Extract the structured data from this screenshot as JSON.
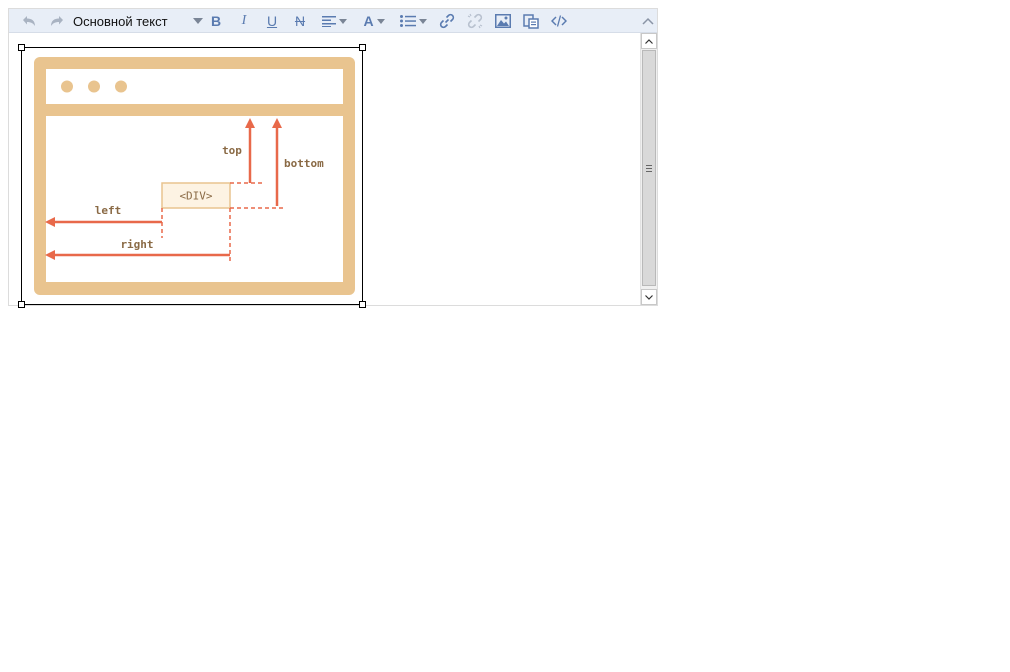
{
  "toolbar": {
    "undo_icon": "undo-icon",
    "redo_icon": "redo-icon",
    "paragraph_style": "Основной текст",
    "bold_label": "B",
    "italic_label": "I",
    "underline_label": "U",
    "strikethrough_label": "N",
    "text_color_label": "A",
    "icons": [
      "align-icon",
      "text-color-icon",
      "list-icon",
      "link-icon",
      "unlink-icon",
      "image-icon",
      "paste-icon",
      "source-code-icon",
      "collapse-toolbar-icon"
    ]
  },
  "diagram": {
    "labels": {
      "top": "top",
      "bottom": "bottom",
      "left": "left",
      "right": "right",
      "element": "<DIV>"
    },
    "colors": {
      "frame": "#e9c48f",
      "arrow": "#e8694a",
      "label": "#8a6a45",
      "box_fill": "#fdf3e3"
    }
  },
  "colors": {
    "toolbar_bg": "#e8eef7",
    "toolbar_icon": "#5a7bb0",
    "toolbar_icon_disabled": "#a9b3c2"
  }
}
